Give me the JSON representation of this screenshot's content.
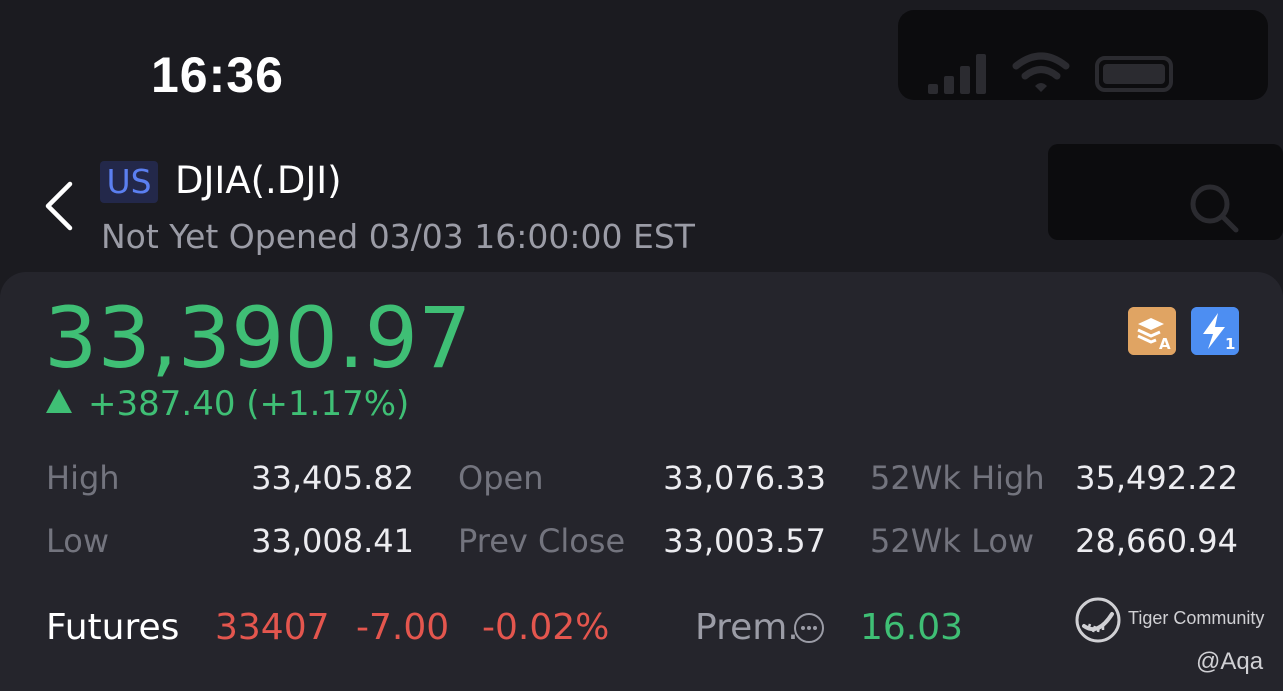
{
  "status_bar": {
    "time": "16:36"
  },
  "header": {
    "market_badge": "US",
    "title": "DJIA(.DJI)",
    "subtitle": "Not Yet Opened 03/03 16:00:00 EST",
    "icons": [
      "back-icon",
      "search-icon"
    ]
  },
  "quote": {
    "price": "33,390.97",
    "change": "+387.40",
    "change_pct": "(+1.17%)",
    "direction": "up",
    "color_up": "#3fbf75",
    "color_down": "#e4564e",
    "icons": [
      "layers-a-icon",
      "flash-1-icon"
    ]
  },
  "stats": [
    {
      "label": "High",
      "value": "33,405.82"
    },
    {
      "label": "Low",
      "value": "33,008.41"
    },
    {
      "label": "Open",
      "value": "33,076.33"
    },
    {
      "label": "Prev Close",
      "value": "33,003.57"
    },
    {
      "label": "52Wk High",
      "value": "35,492.22"
    },
    {
      "label": "52Wk Low",
      "value": "28,660.94"
    }
  ],
  "futures": {
    "label": "Futures",
    "price": "33407",
    "change": "-7.00",
    "change_pct": "-0.02%",
    "prem_label": "Prem.",
    "prem_value": "16.03"
  },
  "watermark": {
    "brand": "Tiger Community",
    "user": "@Aqa"
  }
}
